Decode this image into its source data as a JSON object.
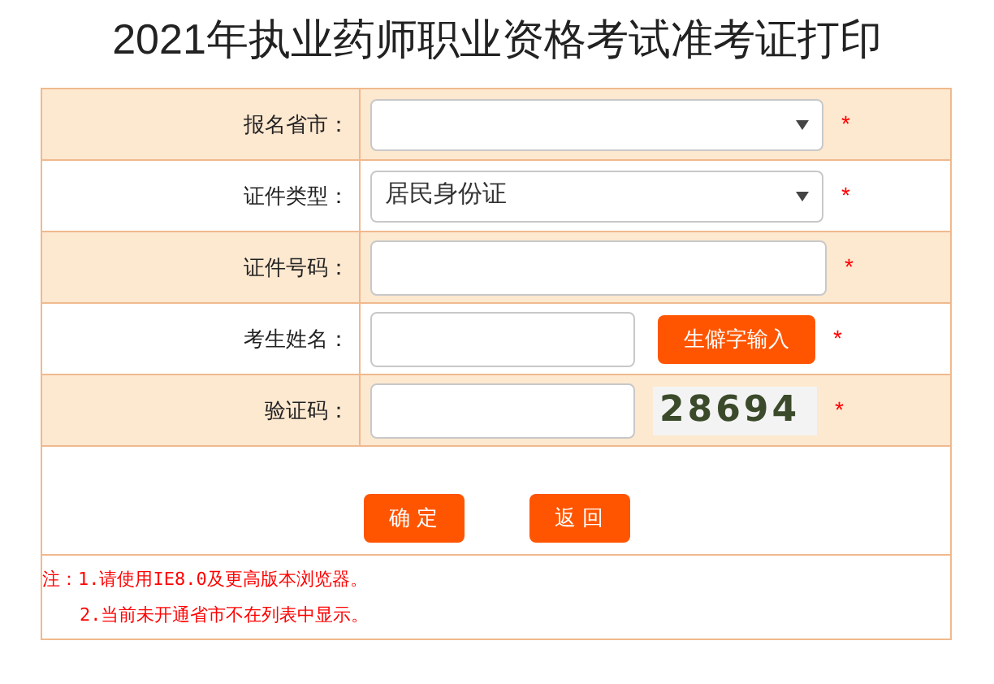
{
  "title": "2021年执业药师职业资格考试准考证打印",
  "rows": [
    {
      "kind": "select",
      "label": "报名省市：",
      "value": "",
      "required": "*"
    },
    {
      "kind": "select",
      "label": "证件类型：",
      "value": "居民身份证",
      "required": "*"
    },
    {
      "kind": "input",
      "label": "证件号码：",
      "required": "*"
    },
    {
      "kind": "input_button",
      "label": "考生姓名：",
      "button": "生僻字输入",
      "required": "*"
    },
    {
      "kind": "captcha",
      "label": "验证码：",
      "captcha": "28694",
      "required": "*"
    }
  ],
  "buttons": [
    "确 定",
    "返 回"
  ],
  "notes": [
    "注：1.请使用IE8.0及更高版本浏览器。",
    "2.当前未开通省市不在列表中显示。"
  ]
}
